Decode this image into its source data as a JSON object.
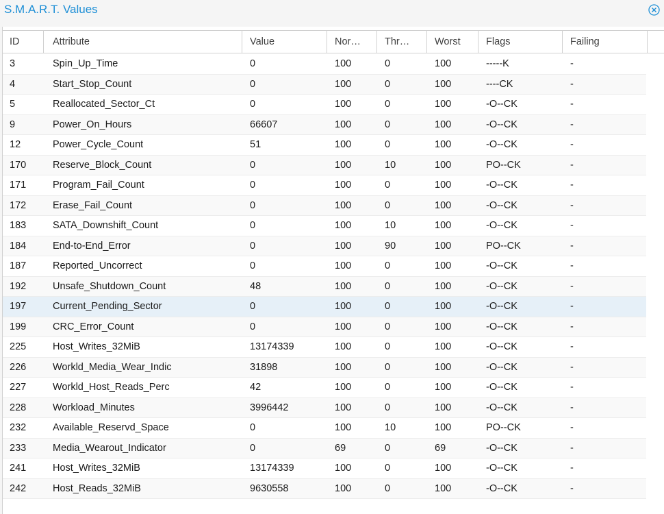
{
  "window": {
    "title": "S.M.A.R.T. Values",
    "close_icon": "close-circle-icon",
    "accent_color": "#1e8fd6"
  },
  "table": {
    "columns": [
      "ID",
      "Attribute",
      "Value",
      "Nor…",
      "Thr…",
      "Worst",
      "Flags",
      "Failing"
    ],
    "selected_row_index": 12,
    "rows": [
      {
        "id": "3",
        "attribute": "Spin_Up_Time",
        "value": "0",
        "normalized": "100",
        "threshold": "0",
        "worst": "100",
        "flags": "-----K",
        "failing": "-"
      },
      {
        "id": "4",
        "attribute": "Start_Stop_Count",
        "value": "0",
        "normalized": "100",
        "threshold": "0",
        "worst": "100",
        "flags": "----CK",
        "failing": "-"
      },
      {
        "id": "5",
        "attribute": "Reallocated_Sector_Ct",
        "value": "0",
        "normalized": "100",
        "threshold": "0",
        "worst": "100",
        "flags": "-O--CK",
        "failing": "-"
      },
      {
        "id": "9",
        "attribute": "Power_On_Hours",
        "value": "66607",
        "normalized": "100",
        "threshold": "0",
        "worst": "100",
        "flags": "-O--CK",
        "failing": "-"
      },
      {
        "id": "12",
        "attribute": "Power_Cycle_Count",
        "value": "51",
        "normalized": "100",
        "threshold": "0",
        "worst": "100",
        "flags": "-O--CK",
        "failing": "-"
      },
      {
        "id": "170",
        "attribute": "Reserve_Block_Count",
        "value": "0",
        "normalized": "100",
        "threshold": "10",
        "worst": "100",
        "flags": "PO--CK",
        "failing": "-"
      },
      {
        "id": "171",
        "attribute": "Program_Fail_Count",
        "value": "0",
        "normalized": "100",
        "threshold": "0",
        "worst": "100",
        "flags": "-O--CK",
        "failing": "-"
      },
      {
        "id": "172",
        "attribute": "Erase_Fail_Count",
        "value": "0",
        "normalized": "100",
        "threshold": "0",
        "worst": "100",
        "flags": "-O--CK",
        "failing": "-"
      },
      {
        "id": "183",
        "attribute": "SATA_Downshift_Count",
        "value": "0",
        "normalized": "100",
        "threshold": "10",
        "worst": "100",
        "flags": "-O--CK",
        "failing": "-"
      },
      {
        "id": "184",
        "attribute": "End-to-End_Error",
        "value": "0",
        "normalized": "100",
        "threshold": "90",
        "worst": "100",
        "flags": "PO--CK",
        "failing": "-"
      },
      {
        "id": "187",
        "attribute": "Reported_Uncorrect",
        "value": "0",
        "normalized": "100",
        "threshold": "0",
        "worst": "100",
        "flags": "-O--CK",
        "failing": "-"
      },
      {
        "id": "192",
        "attribute": "Unsafe_Shutdown_Count",
        "value": "48",
        "normalized": "100",
        "threshold": "0",
        "worst": "100",
        "flags": "-O--CK",
        "failing": "-"
      },
      {
        "id": "197",
        "attribute": "Current_Pending_Sector",
        "value": "0",
        "normalized": "100",
        "threshold": "0",
        "worst": "100",
        "flags": "-O--CK",
        "failing": "-"
      },
      {
        "id": "199",
        "attribute": "CRC_Error_Count",
        "value": "0",
        "normalized": "100",
        "threshold": "0",
        "worst": "100",
        "flags": "-O--CK",
        "failing": "-"
      },
      {
        "id": "225",
        "attribute": "Host_Writes_32MiB",
        "value": "13174339",
        "normalized": "100",
        "threshold": "0",
        "worst": "100",
        "flags": "-O--CK",
        "failing": "-"
      },
      {
        "id": "226",
        "attribute": "Workld_Media_Wear_Indic",
        "value": "31898",
        "normalized": "100",
        "threshold": "0",
        "worst": "100",
        "flags": "-O--CK",
        "failing": "-"
      },
      {
        "id": "227",
        "attribute": "Workld_Host_Reads_Perc",
        "value": "42",
        "normalized": "100",
        "threshold": "0",
        "worst": "100",
        "flags": "-O--CK",
        "failing": "-"
      },
      {
        "id": "228",
        "attribute": "Workload_Minutes",
        "value": "3996442",
        "normalized": "100",
        "threshold": "0",
        "worst": "100",
        "flags": "-O--CK",
        "failing": "-"
      },
      {
        "id": "232",
        "attribute": "Available_Reservd_Space",
        "value": "0",
        "normalized": "100",
        "threshold": "10",
        "worst": "100",
        "flags": "PO--CK",
        "failing": "-"
      },
      {
        "id": "233",
        "attribute": "Media_Wearout_Indicator",
        "value": "0",
        "normalized": "69",
        "threshold": "0",
        "worst": "69",
        "flags": "-O--CK",
        "failing": "-"
      },
      {
        "id": "241",
        "attribute": "Host_Writes_32MiB",
        "value": "13174339",
        "normalized": "100",
        "threshold": "0",
        "worst": "100",
        "flags": "-O--CK",
        "failing": "-"
      },
      {
        "id": "242",
        "attribute": "Host_Reads_32MiB",
        "value": "9630558",
        "normalized": "100",
        "threshold": "0",
        "worst": "100",
        "flags": "-O--CK",
        "failing": "-"
      }
    ]
  }
}
